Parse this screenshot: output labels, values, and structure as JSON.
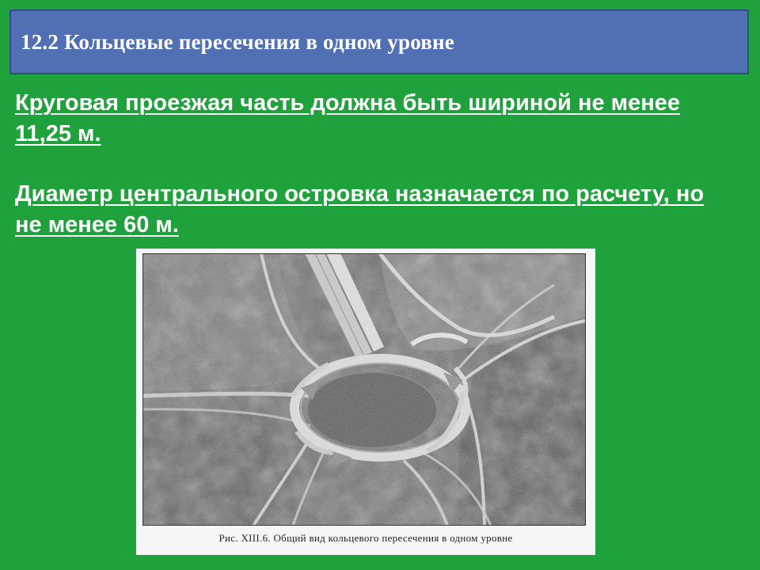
{
  "slide": {
    "title": "12.2 Кольцевые пересечения в одном уровне",
    "paragraph1": "Круговая проезжая часть должна быть шириной не менее 11,25 м. ",
    "paragraph2": "Диаметр центрального островка назначается по расчету, но не менее 60 м."
  },
  "figure": {
    "caption": "Рис. XIII.6. Общий вид кольцевого пересечения в одном уровне"
  },
  "colors": {
    "background": "#1fa23c",
    "title_bar": "#5170b4",
    "title_border": "#2d4f86",
    "text": "#ffffff"
  }
}
